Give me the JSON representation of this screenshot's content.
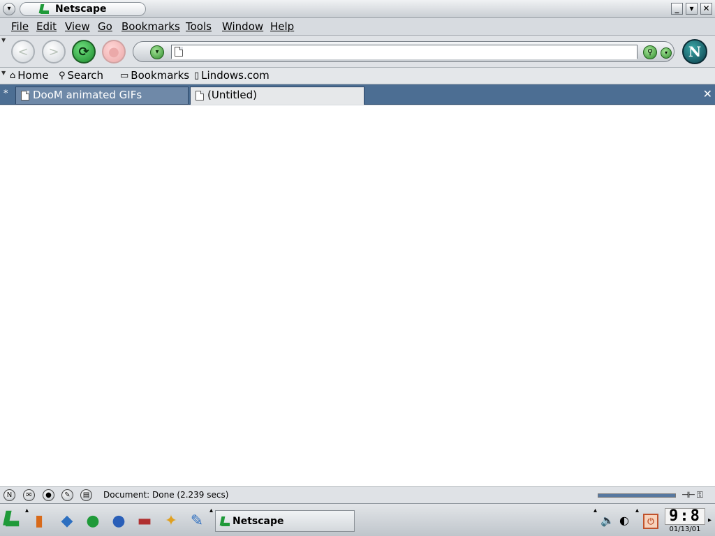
{
  "window": {
    "title": "Netscape",
    "menu_glyph": "▾",
    "minimize": "_",
    "maximize": "▾",
    "close": "✕"
  },
  "menubar": {
    "items": [
      "File",
      "Edit",
      "View",
      "Go",
      "Bookmarks",
      "Tools",
      "Window",
      "Help"
    ]
  },
  "navbar": {
    "back_glyph": "<",
    "forward_glyph": ">",
    "reload_glyph": "⟳",
    "stop_glyph": "●",
    "url_value": "",
    "url_dropdown_glyph": "▾",
    "url_go_glyph": "▾",
    "search_glyph": "⚲",
    "netscape_logo": "N"
  },
  "personal_toolbar": {
    "home": "Home",
    "search": "Search",
    "bookmarks": "Bookmarks",
    "lindows": "Lindows.com"
  },
  "tabs": {
    "items": [
      {
        "label": "DooM animated GIFs",
        "active": false
      },
      {
        "label": "(Untitled)",
        "active": true
      }
    ],
    "close_glyph": "✕",
    "new_glyph": "*"
  },
  "statusbar": {
    "text": "Document: Done (2.239 secs)",
    "progress": 1.0
  },
  "taskbar": {
    "task_label": "Netscape",
    "clock_time": "9:8",
    "clock_date": "01/13/01"
  },
  "colors": {
    "tab_bar": "#4c6e93",
    "reload_green": "#1c8a2d",
    "brand_green": "#1f9a39"
  }
}
